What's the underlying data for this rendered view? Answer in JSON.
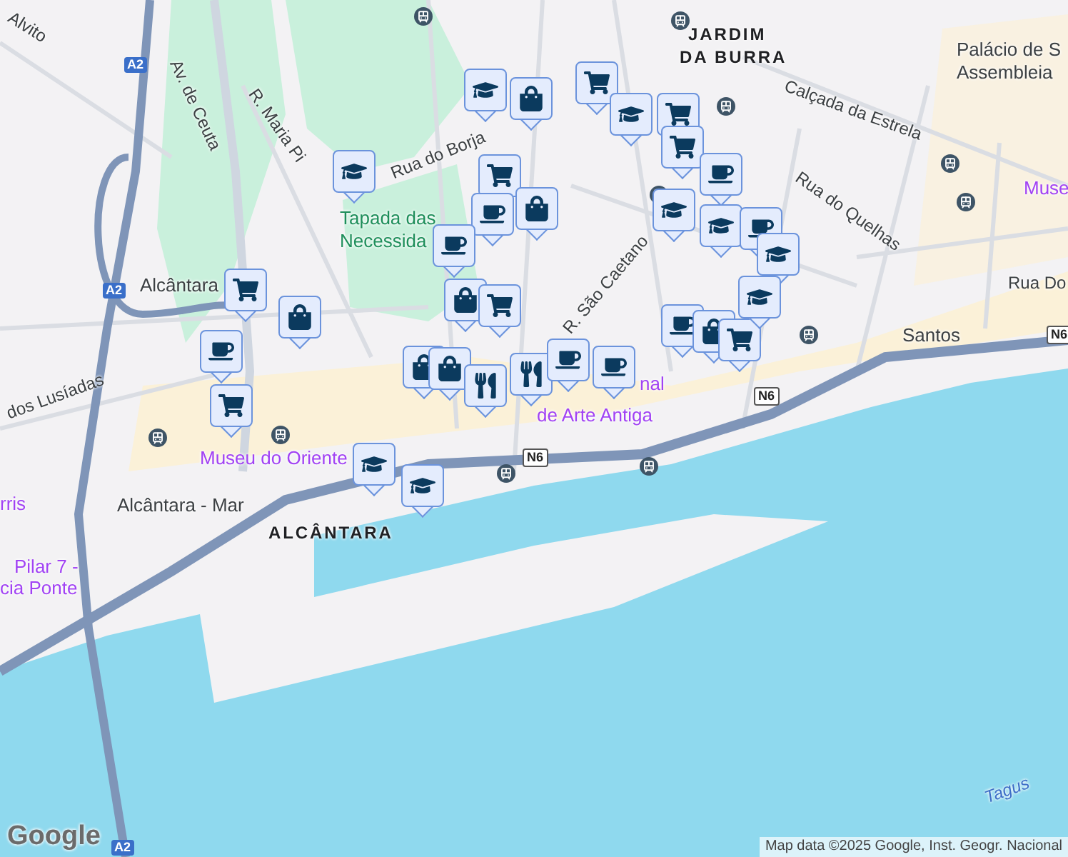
{
  "map": {
    "labels": [
      {
        "text": "Alvito",
        "kind": "street"
      },
      {
        "text": "Av. de Ceuta",
        "kind": "street"
      },
      {
        "text": "R. Maria Pi",
        "kind": "street"
      },
      {
        "text": "Rua do Borja",
        "kind": "street"
      },
      {
        "text": "Tapada das",
        "kind": "park"
      },
      {
        "text": "Necessida",
        "kind": "park"
      },
      {
        "text": "Alcântara",
        "kind": "place"
      },
      {
        "text": "dos Lusíadas",
        "kind": "street"
      },
      {
        "text": "JARDIM",
        "kind": "district"
      },
      {
        "text": "DA BURRA",
        "kind": "district"
      },
      {
        "text": "Calçada da Estrela",
        "kind": "street"
      },
      {
        "text": "Palácio de S",
        "kind": "place"
      },
      {
        "text": "Assembleia",
        "kind": "place"
      },
      {
        "text": "Rua do Quelhas",
        "kind": "street"
      },
      {
        "text": "Muse",
        "kind": "poi"
      },
      {
        "text": "R. São Caetano",
        "kind": "street"
      },
      {
        "text": "Rua Do",
        "kind": "street"
      },
      {
        "text": "Santos",
        "kind": "place"
      },
      {
        "text": "nal",
        "kind": "poi"
      },
      {
        "text": "de Arte Antiga",
        "kind": "poi"
      },
      {
        "text": "Museu do Oriente",
        "kind": "poi"
      },
      {
        "text": "Alcântara - Mar",
        "kind": "place"
      },
      {
        "text": "ALCÂNTARA",
        "kind": "district"
      },
      {
        "text": "rris",
        "kind": "poi"
      },
      {
        "text": "Pilar 7 -",
        "kind": "poi"
      },
      {
        "text": "cia Ponte",
        "kind": "poi"
      },
      {
        "text": "Tagus",
        "kind": "water"
      }
    ],
    "shields": [
      "A2",
      "A2",
      "A2",
      "N6",
      "N6",
      "N6"
    ],
    "markers": [
      {
        "kind": "school"
      },
      {
        "kind": "shop"
      },
      {
        "kind": "cart"
      },
      {
        "kind": "school"
      },
      {
        "kind": "cart"
      },
      {
        "kind": "cart"
      },
      {
        "kind": "cafe"
      },
      {
        "kind": "school"
      },
      {
        "kind": "cart"
      },
      {
        "kind": "cafe"
      },
      {
        "kind": "shop"
      },
      {
        "kind": "school"
      },
      {
        "kind": "school"
      },
      {
        "kind": "cafe"
      },
      {
        "kind": "school"
      },
      {
        "kind": "cafe"
      },
      {
        "kind": "shop"
      },
      {
        "kind": "cart"
      },
      {
        "kind": "cart"
      },
      {
        "kind": "shop"
      },
      {
        "kind": "cafe"
      },
      {
        "kind": "cart"
      },
      {
        "kind": "cafe"
      },
      {
        "kind": "shop"
      },
      {
        "kind": "cart"
      },
      {
        "kind": "school"
      },
      {
        "kind": "shop"
      },
      {
        "kind": "shop"
      },
      {
        "kind": "restaurant"
      },
      {
        "kind": "restaurant"
      },
      {
        "kind": "cafe"
      },
      {
        "kind": "cafe"
      },
      {
        "kind": "school"
      },
      {
        "kind": "school"
      }
    ],
    "logo": "Google",
    "attribution": "Map data ©2025 Google, Inst. Geogr. Nacional"
  }
}
